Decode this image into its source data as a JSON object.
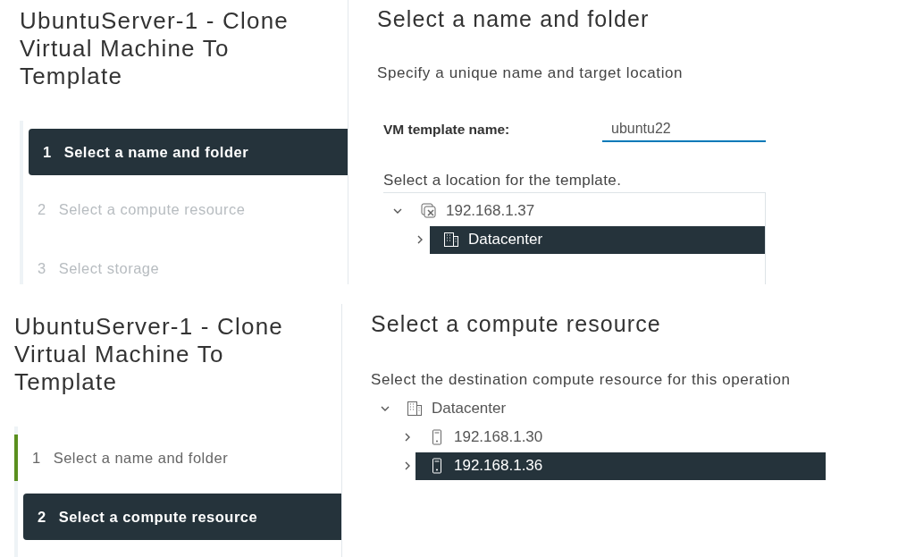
{
  "panels": [
    {
      "title": "UbuntuServer-1 - Clone Virtual Machine To Template",
      "steps": [
        {
          "number": "1",
          "label": "Select a name and folder",
          "selected": true,
          "completed": false,
          "disabled": false
        },
        {
          "number": "2",
          "label": "Select a compute resource",
          "selected": false,
          "completed": false,
          "disabled": true
        },
        {
          "number": "3",
          "label": "Select storage",
          "selected": false,
          "completed": false,
          "disabled": true
        }
      ],
      "content": {
        "kind": "name-folder",
        "heading": "Select a name and folder",
        "subtitle": "Specify a unique name and target location",
        "field": {
          "label": "VM template name:",
          "value": "ubuntu22"
        },
        "location_label": "Select a location for the template.",
        "tree": [
          {
            "label": "192.168.1.37",
            "kind": "vcenter",
            "expanded": true,
            "selected": false,
            "children": [
              {
                "label": "Datacenter",
                "kind": "datacenter",
                "expanded": false,
                "selected": true
              }
            ]
          }
        ]
      }
    },
    {
      "title": "UbuntuServer-1 - Clone Virtual Machine To Template",
      "steps": [
        {
          "number": "1",
          "label": "Select a name and folder",
          "selected": false,
          "completed": true,
          "disabled": false
        },
        {
          "number": "2",
          "label": "Select a compute resource",
          "selected": true,
          "completed": false,
          "disabled": false
        }
      ],
      "content": {
        "kind": "compute",
        "heading": "Select a compute resource",
        "subtitle": "Select the destination compute resource for this operation",
        "tree": [
          {
            "label": "Datacenter",
            "kind": "datacenter",
            "expanded": true,
            "selected": false,
            "children": [
              {
                "label": "192.168.1.30",
                "kind": "host",
                "expanded": false,
                "selected": false
              },
              {
                "label": "192.168.1.36",
                "kind": "host",
                "expanded": false,
                "selected": true
              }
            ]
          }
        ]
      }
    }
  ]
}
